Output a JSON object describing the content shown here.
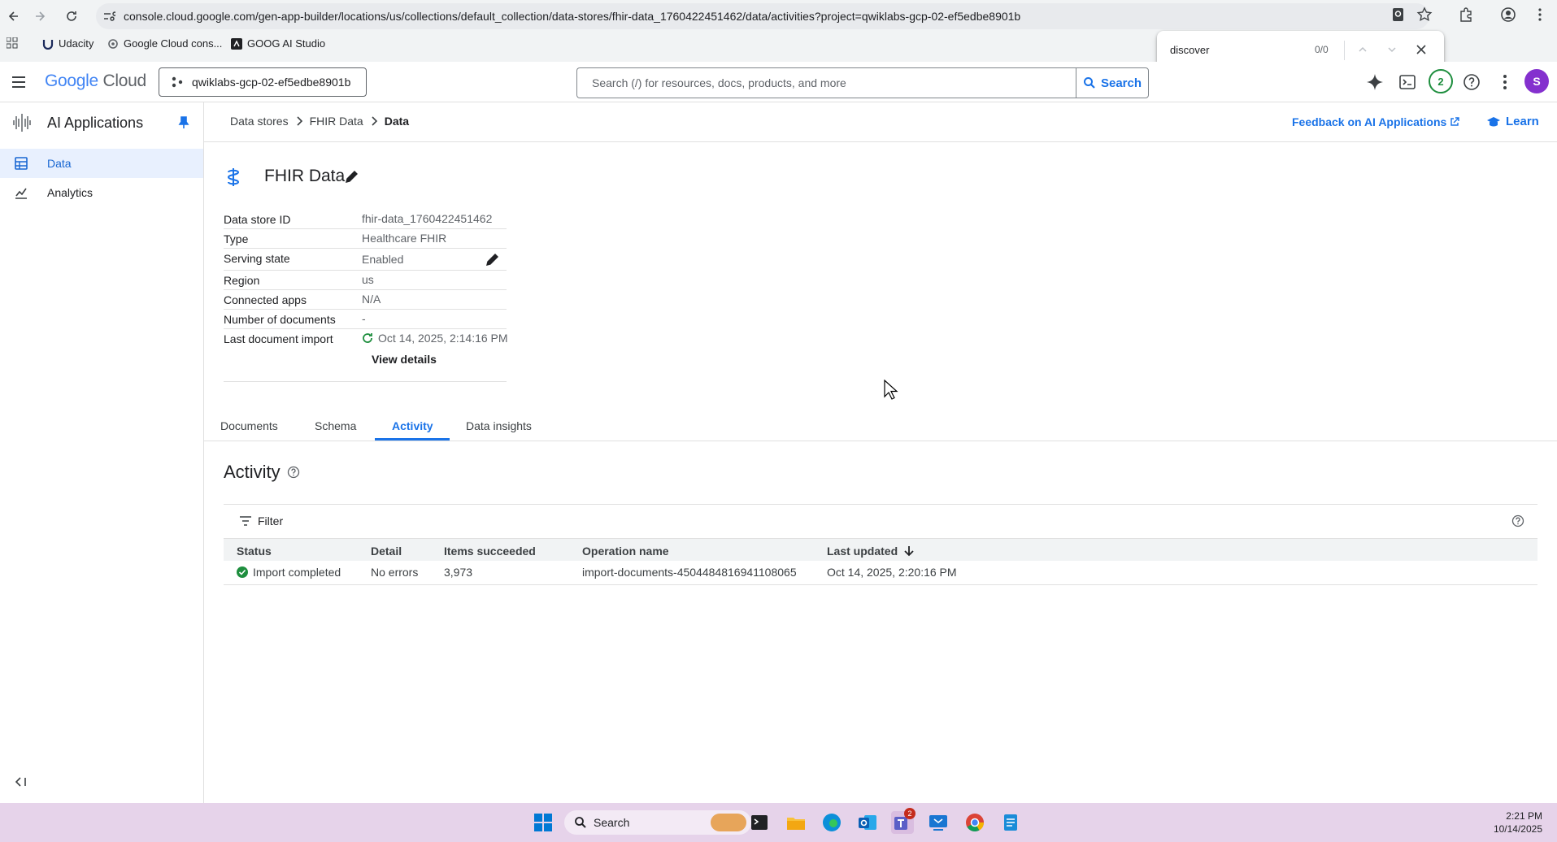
{
  "browser": {
    "url": "console.cloud.google.com/gen-app-builder/locations/us/collections/default_collection/data-stores/fhir-data_1760422451462/data/activities?project=qwiklabs-gcp-02-ef5edbe8901b",
    "bookmarks": [
      "Udacity",
      "Google Cloud cons...",
      "GOOG AI Studio"
    ],
    "find": {
      "query": "discover",
      "count": "0/0"
    }
  },
  "header": {
    "logo_google": "Google",
    "logo_cloud": "Cloud",
    "project": "qwiklabs-gcp-02-ef5edbe8901b",
    "search_placeholder": "Search (/) for resources, docs, products, and more",
    "search_button": "Search",
    "notification_count": "2",
    "avatar_letter": "S"
  },
  "sidebar": {
    "title": "AI Applications",
    "items": [
      {
        "label": "Data",
        "active": true
      },
      {
        "label": "Analytics",
        "active": false
      }
    ]
  },
  "breadcrumb": {
    "items": [
      "Data stores",
      "FHIR Data",
      "Data"
    ],
    "feedback": "Feedback on AI Applications",
    "learn": "Learn"
  },
  "datastore": {
    "title": "FHIR Data",
    "details": [
      {
        "key": "Data store ID",
        "value": "fhir-data_1760422451462"
      },
      {
        "key": "Type",
        "value": "Healthcare FHIR"
      },
      {
        "key": "Serving state",
        "value": "Enabled"
      },
      {
        "key": "Region",
        "value": "us"
      },
      {
        "key": "Connected apps",
        "value": "N/A"
      },
      {
        "key": "Number of documents",
        "value": "-"
      },
      {
        "key": "Last document import",
        "value": "Oct 14, 2025, 2:14:16 PM"
      }
    ],
    "view_details": "View details"
  },
  "tabs": [
    "Documents",
    "Schema",
    "Activity",
    "Data insights"
  ],
  "activity": {
    "title": "Activity",
    "filter": "Filter",
    "columns": [
      "Status",
      "Detail",
      "Items succeeded",
      "Operation name",
      "Last updated"
    ],
    "rows": [
      {
        "status": "Import completed",
        "detail": "No errors",
        "items": "3,973",
        "operation": "import-documents-4504484816941108065",
        "updated": "Oct 14, 2025, 2:20:16 PM"
      }
    ]
  },
  "taskbar": {
    "search": "Search",
    "teams_badge": "2",
    "time": "2:21 PM",
    "date": "10/14/2025"
  },
  "colors": {
    "accent": "#1a73e8",
    "success": "#1e8e3e",
    "taskbar": "#e6d3ea"
  }
}
